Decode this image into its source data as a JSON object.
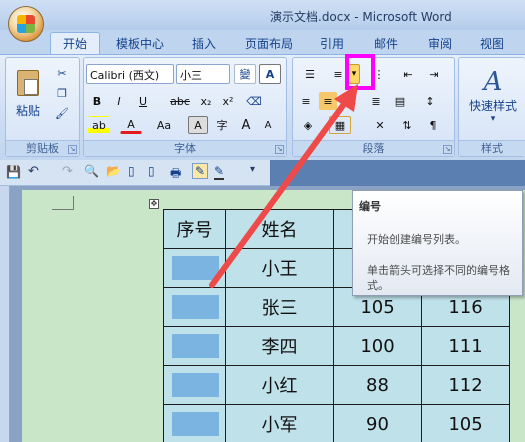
{
  "window": {
    "title": "演示文档.docx - Microsoft Word"
  },
  "tabs": [
    "开始",
    "模板中心",
    "插入",
    "页面布局",
    "引用",
    "邮件",
    "审阅",
    "视图"
  ],
  "ribbon": {
    "clipboard": {
      "label": "剪贴板",
      "paste": "粘贴"
    },
    "font": {
      "label": "字体",
      "font_name": "Calibri (西文)",
      "font_size": "小三",
      "wen": "變",
      "A_box": "A",
      "bold": "B",
      "italic": "I",
      "underline": "U",
      "strike": "abc",
      "sub": "x₂",
      "sup": "x²",
      "aa": "Aa",
      "a_big": "A",
      "a_small": "A",
      "circle": "字"
    },
    "paragraph": {
      "label": "段落"
    },
    "styles": {
      "label": "样式",
      "quick": "快速样式",
      "arrow": "▾"
    }
  },
  "tooltip": {
    "title": "编号",
    "line1": "开始创建编号列表。",
    "line2": "单击箭头可选择不同的编号格式。"
  },
  "table": {
    "headers": [
      "序号",
      "姓名",
      "",
      ""
    ],
    "rows": [
      {
        "name": "小王",
        "a": "",
        "b": ""
      },
      {
        "name": "张三",
        "a": "105",
        "b": "116"
      },
      {
        "name": "李四",
        "a": "100",
        "b": "111"
      },
      {
        "name": "小红",
        "a": "88",
        "b": "112"
      },
      {
        "name": "小军",
        "a": "90",
        "b": "105"
      }
    ]
  },
  "colors": {
    "highlight": "#ff00ff",
    "arrow": "#ef4a4a"
  }
}
